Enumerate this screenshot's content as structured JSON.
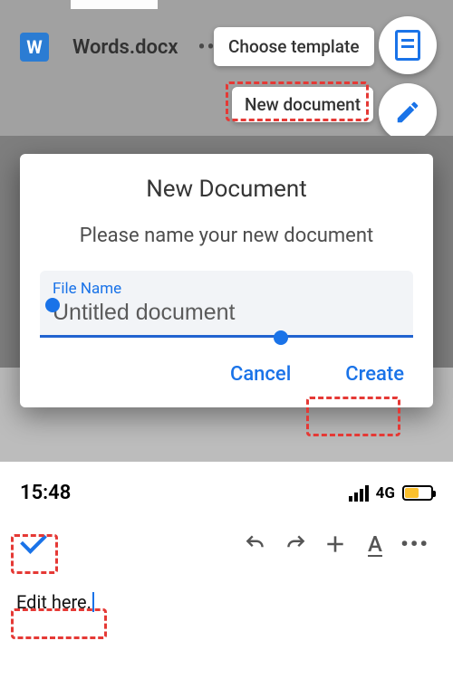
{
  "background": {
    "doc_badge_letter": "W",
    "doc_title": "Words.docx",
    "menu": {
      "choose_template": "Choose template",
      "new_document": "New document"
    }
  },
  "dialog": {
    "title": "New Document",
    "subtitle": "Please name your new document",
    "field_label": "File Name",
    "field_value": "Untitled document",
    "cancel": "Cancel",
    "create": "Create"
  },
  "editor": {
    "clock": "15:48",
    "network": "4G",
    "body_text": "Edit here."
  }
}
